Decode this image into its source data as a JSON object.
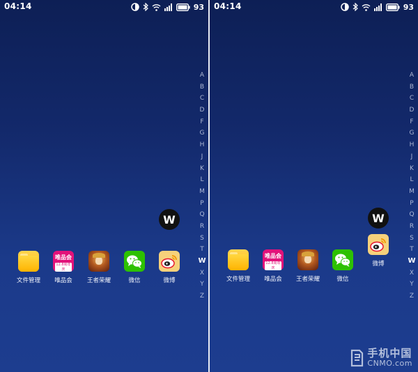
{
  "status_bar": {
    "time": "04:14",
    "battery_percent": "93"
  },
  "alphabet_index": [
    "A",
    "B",
    "C",
    "D",
    "F",
    "G",
    "H",
    "J",
    "K",
    "L",
    "M",
    "P",
    "Q",
    "R",
    "S",
    "T",
    "W",
    "X",
    "Y",
    "Z"
  ],
  "active_letter": "W",
  "bubble_letter": "W",
  "left_panel": {
    "apps": [
      {
        "name": "文件管理",
        "icon": "folder-icon"
      },
      {
        "name": "唯品会",
        "icon": "vipshop-icon"
      },
      {
        "name": "王者荣耀",
        "icon": "game-icon"
      },
      {
        "name": "微信",
        "icon": "wechat-icon"
      },
      {
        "name": "微博",
        "icon": "weibo-icon"
      }
    ]
  },
  "right_panel": {
    "apps": [
      {
        "name": "文件管理",
        "icon": "folder-icon"
      },
      {
        "name": "唯品会",
        "icon": "vipshop-icon"
      },
      {
        "name": "王者荣耀",
        "icon": "game-icon"
      },
      {
        "name": "微信",
        "icon": "wechat-icon"
      },
      {
        "name": "微博",
        "icon": "weibo-icon"
      }
    ]
  },
  "vip_icon_text": {
    "main": "唯品会",
    "sub": "12.8周年庆"
  },
  "watermark": {
    "cn": "手机中国",
    "en": "CNMO.com"
  },
  "colors": {
    "wechat": "#2dc100",
    "vipshop": "#e2127a",
    "folder": "#ffb300",
    "weibo": "#f6d17b",
    "bubble": "#111111"
  }
}
